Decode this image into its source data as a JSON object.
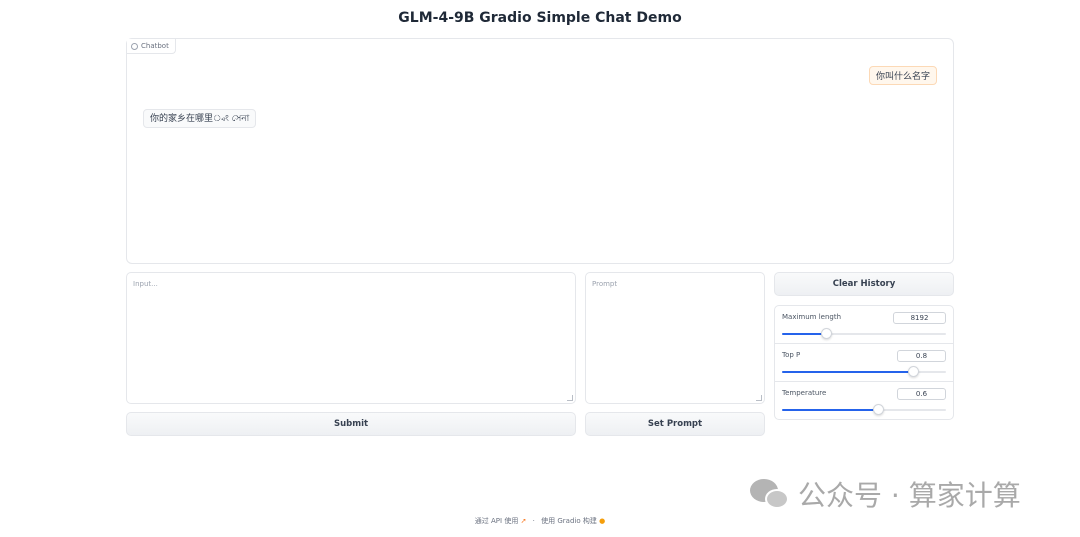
{
  "header": {
    "title": "GLM-4-9B Gradio Simple Chat Demo"
  },
  "chatbot": {
    "label": "Chatbot",
    "messages": [
      {
        "role": "user",
        "text": "你叫什么名字"
      },
      {
        "role": "assistant",
        "text": "你的家乡在哪里্বং সেনা"
      }
    ]
  },
  "input": {
    "placeholder": "Input..."
  },
  "prompt": {
    "placeholder": "Prompt"
  },
  "buttons": {
    "submit": "Submit",
    "set_prompt": "Set Prompt",
    "clear_history": "Clear History"
  },
  "sliders": [
    {
      "label": "Maximum length",
      "value": "8192",
      "fraction": 0.27
    },
    {
      "label": "Top P",
      "value": "0.8",
      "fraction": 0.8
    },
    {
      "label": "Temperature",
      "value": "0.6",
      "fraction": 0.59
    }
  ],
  "watermark": {
    "text": "公众号 · 算家计算"
  },
  "footer": {
    "api_text": "通过 API 使用",
    "separator": "·",
    "built_text": "使用 Gradio 构建"
  },
  "colors": {
    "accent": "#2563eb",
    "user_bubble": "#fff7ed"
  }
}
